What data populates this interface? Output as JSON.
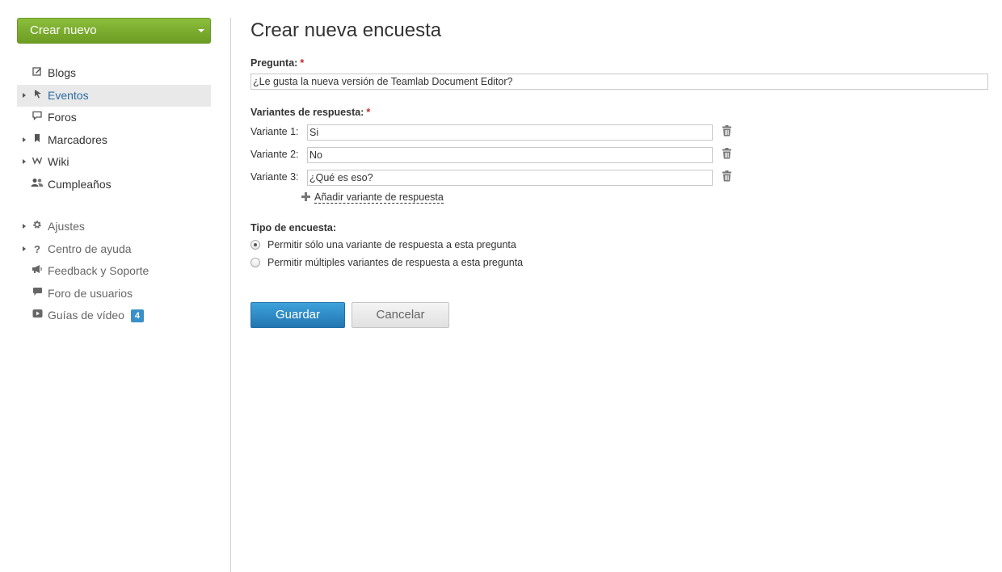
{
  "sidebar": {
    "create_button": "Crear nuevo",
    "modules": [
      {
        "label": "Blogs",
        "icon": "edit-icon",
        "expandable": false,
        "active": false
      },
      {
        "label": "Eventos",
        "icon": "pin-icon",
        "expandable": true,
        "active": true
      },
      {
        "label": "Foros",
        "icon": "comment-icon",
        "expandable": false,
        "active": false
      },
      {
        "label": "Marcadores",
        "icon": "bookmark-icon",
        "expandable": true,
        "active": false
      },
      {
        "label": "Wiki",
        "icon": "wiki-icon",
        "expandable": true,
        "active": false
      },
      {
        "label": "Cumpleaños",
        "icon": "users-icon",
        "expandable": false,
        "active": false
      }
    ],
    "settings": [
      {
        "label": "Ajustes",
        "icon": "gear-icon",
        "expandable": true
      },
      {
        "label": "Centro de ayuda",
        "icon": "question-icon",
        "expandable": true
      },
      {
        "label": "Feedback y Soporte",
        "icon": "megaphone-icon",
        "expandable": false
      },
      {
        "label": "Foro de usuarios",
        "icon": "speech-bubble-icon",
        "expandable": false
      },
      {
        "label": "Guías de vídeo",
        "icon": "video-icon",
        "expandable": false,
        "badge": "4"
      }
    ]
  },
  "main": {
    "title": "Crear nueva encuesta",
    "question_label": "Pregunta:",
    "question_value": "¿Le gusta la nueva versión de Teamlab Document Editor?",
    "variants_label": "Variantes de respuesta:",
    "required_mark": "*",
    "variants": [
      {
        "label": "Variante 1:",
        "value": "Si"
      },
      {
        "label": "Variante 2:",
        "value": "No"
      },
      {
        "label": "Variante 3:",
        "value": "¿Qué es eso?"
      }
    ],
    "add_variant": "Añadir variante de respuesta",
    "poll_type_label": "Tipo de encuesta:",
    "poll_types": [
      {
        "label": "Permitir sólo una variante de respuesta a esta pregunta",
        "checked": true
      },
      {
        "label": "Permitir múltiples variantes de respuesta a esta pregunta",
        "checked": false
      }
    ],
    "save_label": "Guardar",
    "cancel_label": "Cancelar"
  },
  "colors": {
    "create_button": "#7bab2f",
    "active_link": "#2b6aa5",
    "save_button": "#2a83c0",
    "badge": "#3a8fc9",
    "required": "#c4282a"
  }
}
